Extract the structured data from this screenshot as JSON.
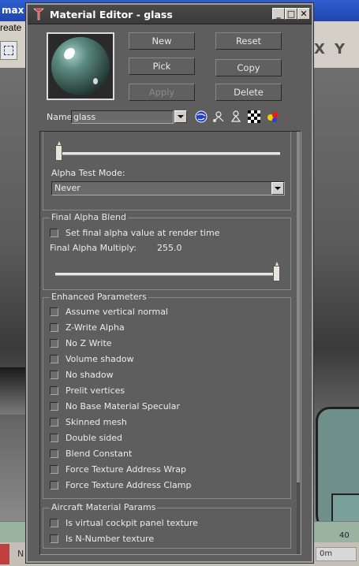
{
  "app": {
    "title_fragment": "max -",
    "menu_fragment": "reate",
    "status_letter": "N",
    "track_number": "40",
    "frame_field": "0m",
    "toolbar_x": "X",
    "toolbar_y": "Y"
  },
  "window": {
    "title": "Material Editor - glass",
    "minimize": "_",
    "maximize": "□",
    "close": "✕"
  },
  "buttons": {
    "new": "New",
    "reset": "Reset",
    "pick": "Pick",
    "copy": "Copy",
    "apply": "Apply",
    "delete": "Delete"
  },
  "name_row": {
    "label": "Name",
    "value": "glass"
  },
  "alpha_test": {
    "label": "Alpha Test Mode:",
    "selected": "Never",
    "slider_value": 0.02
  },
  "final_alpha_blend": {
    "title": "Final Alpha Blend",
    "checkbox_label": "Set final alpha value at render time",
    "multiply_label": "Final Alpha Multiply:",
    "multiply_value": "255.0",
    "slider_value": 1.0
  },
  "enhanced": {
    "title": "Enhanced Parameters",
    "items": [
      "Assume vertical normal",
      "Z-Write Alpha",
      "No Z Write",
      "Volume shadow",
      "No shadow",
      "Prelit vertices",
      "No Base Material Specular",
      "Skinned mesh",
      "Double sided",
      "Blend Constant",
      "Force Texture Address Wrap",
      "Force Texture Address Clamp"
    ]
  },
  "aircraft": {
    "title": "Aircraft Material Params",
    "items": [
      "Is virtual cockpit panel texture",
      "Is N-Number texture"
    ]
  },
  "colors": {
    "dialog_bg": "#5e5e5e",
    "sphere": "#5a8a80"
  }
}
